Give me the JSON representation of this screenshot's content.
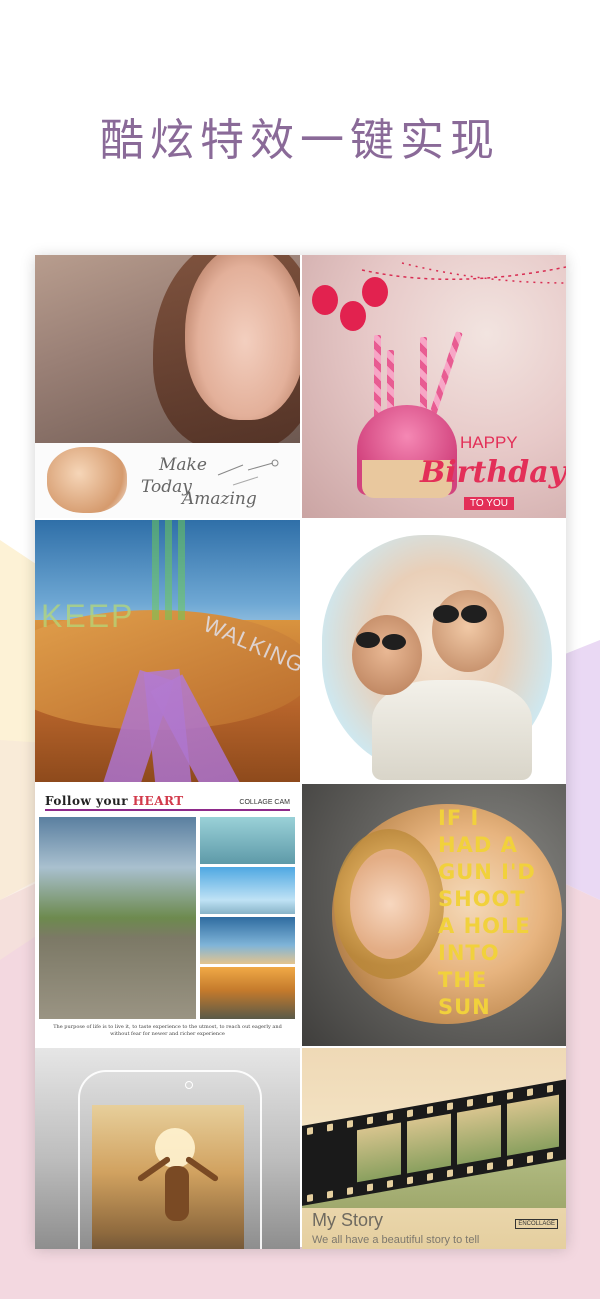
{
  "headline": "酷炫特效一键实现",
  "colors": {
    "headline": "#8a6a98",
    "bg_pink": "#f3d8e0",
    "bg_yellow": "#fdf2d6",
    "bg_purple": "#e4d2f2"
  },
  "tiles": {
    "t1": {
      "make": "Make",
      "today": "Today",
      "amazing": "Amazing"
    },
    "t2": {
      "happy": "HAPPY",
      "birthday": "Birthday",
      "to_you": "TO YOU"
    },
    "t3": {
      "keep": "KEEP",
      "walking": "WALKING"
    },
    "t5": {
      "follow": "Follow your",
      "heart": "HEART",
      "brand": "COLLAGE CAM",
      "caption": "The purpose of life is to live it, to taste experience to the utmost, to reach out eagerly and without fear for newer and richer experience"
    },
    "t6": {
      "lines": [
        "IF I",
        "HAD A",
        "GUN I'D",
        "SHOOT",
        "A HOLE",
        "INTO",
        "THE",
        "SUN"
      ]
    },
    "t8": {
      "title": "My Story",
      "subtitle": "We all have a beautiful story to tell",
      "logo": "ENCOLLAGE"
    }
  }
}
